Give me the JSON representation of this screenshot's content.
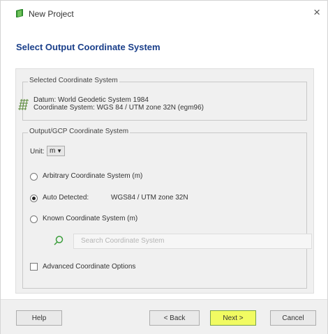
{
  "window": {
    "title": "New Project",
    "close_label": "×"
  },
  "heading": "Select Output Coordinate System",
  "selected_group": {
    "title": "Selected Coordinate System",
    "datum": "Datum: World Geodetic System 1984",
    "coordinate_system": "Coordinate System: WGS 84 / UTM zone 32N (egm96)"
  },
  "output_group": {
    "title": "Output/GCP Coordinate System",
    "units_label": "Unit:",
    "units_value": "m",
    "options": [
      {
        "label": "Arbitrary Coordinate System (m)",
        "selected": false
      },
      {
        "label": "Auto Detected:",
        "selected": true,
        "detected_value": "WGS84 / UTM zone 32N"
      },
      {
        "label": "Known Coordinate System (m)",
        "selected": false
      }
    ],
    "search_placeholder": "Search Coordinate System",
    "advanced_label": "Advanced Coordinate Options"
  },
  "buttons": {
    "help": "Help",
    "back": "< Back",
    "next": "Next >",
    "cancel": "Cancel"
  },
  "colors": {
    "heading": "#1a3f8a",
    "next_button": "#f1fb62",
    "app_icon": "#2e8b2e"
  },
  "icons": {
    "app": "pix4d-icon",
    "close": "close-icon",
    "grid": "grid-icon",
    "search": "search-icon"
  }
}
